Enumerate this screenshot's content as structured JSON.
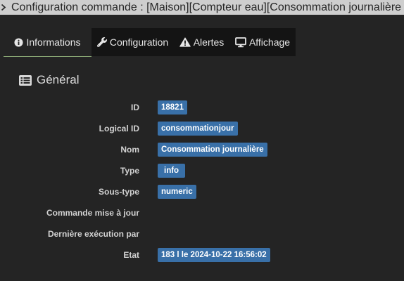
{
  "window": {
    "title": "Configuration commande : [Maison][Compteur eau][Consommation journalière",
    "chevron_icon": "chevron-right-icon"
  },
  "tabs": [
    {
      "label": "Informations",
      "icon": "info-circle-icon",
      "active": true
    },
    {
      "label": "Configuration",
      "icon": "wrench-icon",
      "active": false
    },
    {
      "label": "Alertes",
      "icon": "warning-triangle-icon",
      "active": false
    },
    {
      "label": "Affichage",
      "icon": "desktop-icon",
      "active": false
    }
  ],
  "section": {
    "title": "Général",
    "icon": "list-alt-icon"
  },
  "fields": [
    {
      "label": "ID",
      "value": "18821"
    },
    {
      "label": "Logical ID",
      "value": "consommationjour"
    },
    {
      "label": "Nom",
      "value": "Consommation journalière"
    },
    {
      "label": "Type",
      "value": "info"
    },
    {
      "label": "Sous-type",
      "value": "numeric"
    },
    {
      "label": "Commande mise à jour"
    },
    {
      "label": "Dernière exécution par"
    },
    {
      "label": "Etat",
      "value": "183 l le 2024-10-22 16:56:02"
    }
  ],
  "colors": {
    "page_bg": "#242424",
    "top_bar_bg": "#cecece",
    "tab_bar_bg": "#141414",
    "active_tab_underline": "#8fae78",
    "badge_bg": "#3970a8"
  }
}
